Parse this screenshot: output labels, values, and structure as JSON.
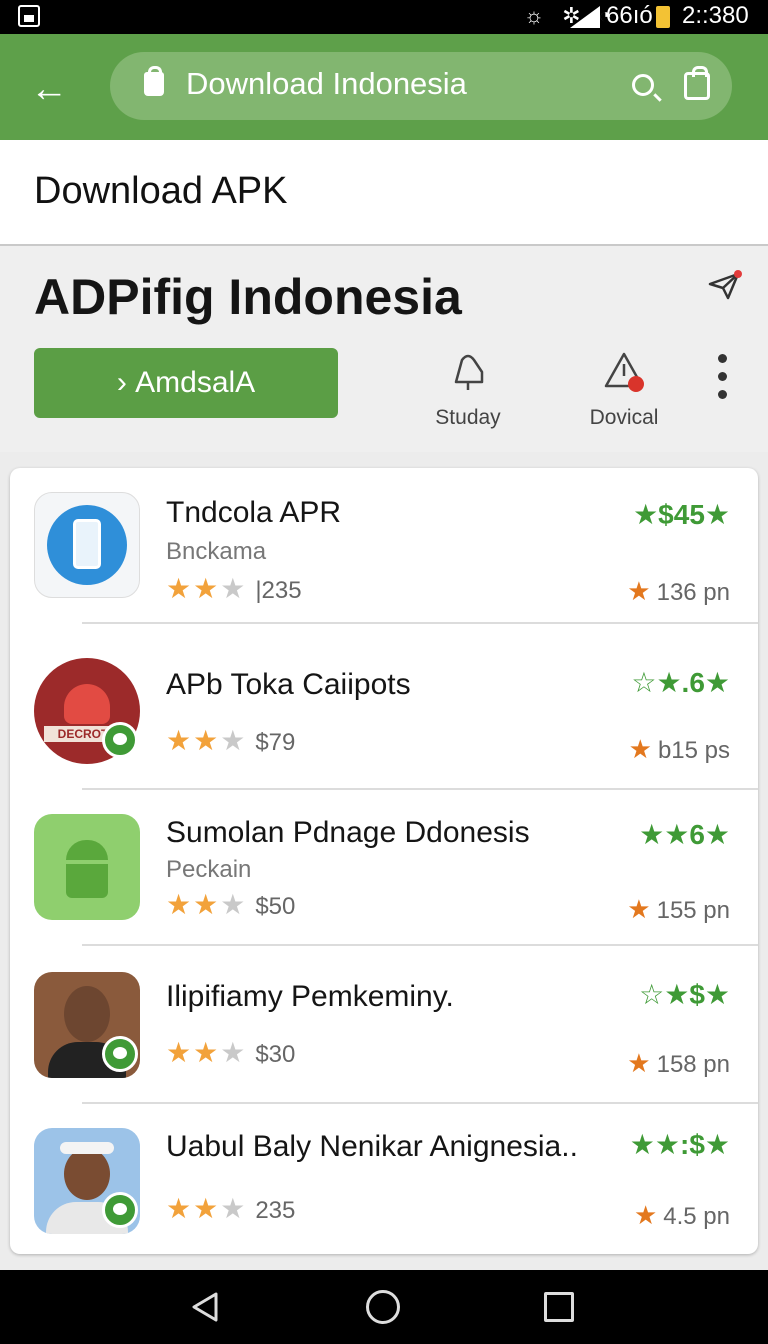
{
  "status_bar": {
    "battery": "66ıó",
    "time": "2::380"
  },
  "app_bar": {
    "url_text": "Download  Indonesia"
  },
  "title_bar": {
    "title": "Download APK"
  },
  "header": {
    "heading": "ADPifig Indonesia",
    "primary_button": "AmdsalA",
    "actions": [
      {
        "label": "Studay"
      },
      {
        "label": "Dovical"
      }
    ]
  },
  "apps": [
    {
      "name": "Tndcola APR",
      "subtitle": "Bnckama",
      "rating_text": "|235",
      "price": "★$45★",
      "size": "136 pn"
    },
    {
      "name": "APb Toka Caiipots",
      "subtitle": "",
      "rating_text": "$79",
      "price": "☆★.6★",
      "size": "b15 ps"
    },
    {
      "name": "Sumolan Pdnage Ddonesis",
      "subtitle": "Peckain",
      "rating_text": "$50",
      "price": "★★6★",
      "size": "155 pn"
    },
    {
      "name": "Ilipifiamy Pemkeminy.",
      "subtitle": "",
      "rating_text": "$30",
      "price": "☆★$★",
      "size": "158 pn"
    },
    {
      "name": "Uabul Baly Nenikar Anignesia..",
      "subtitle": "",
      "rating_text": "235",
      "price": "★★:$★",
      "size": "4.5 pn"
    }
  ],
  "colors": {
    "brand_green": "#5ea04a",
    "price_green": "#3f9a36",
    "star_orange": "#f2a23b"
  }
}
